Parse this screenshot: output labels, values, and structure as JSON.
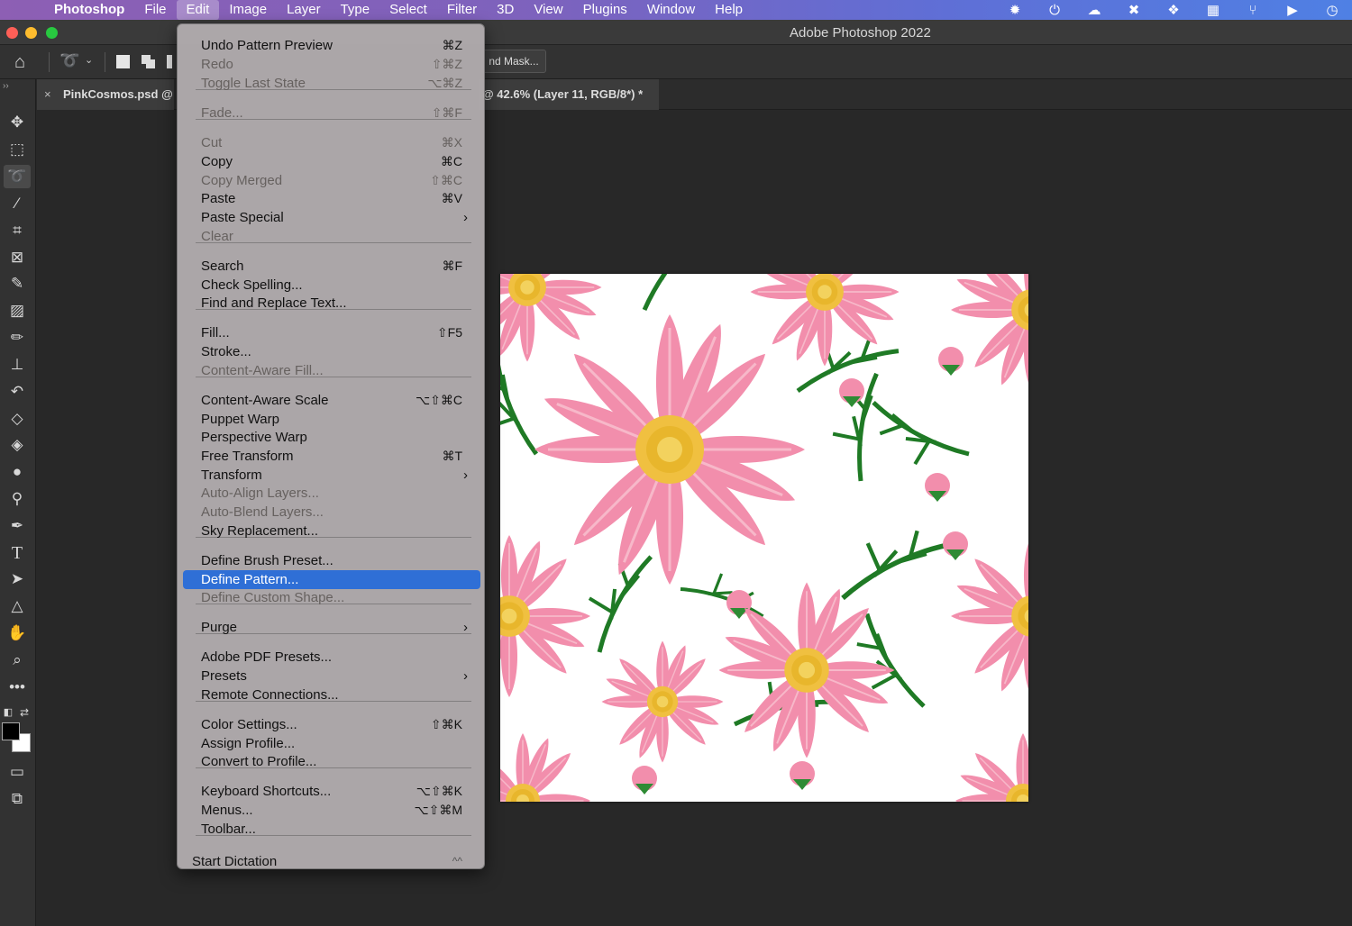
{
  "menubar": {
    "app_name": "Photoshop",
    "items": [
      "File",
      "Edit",
      "Image",
      "Layer",
      "Type",
      "Select",
      "Filter",
      "3D",
      "View",
      "Plugins",
      "Window",
      "Help"
    ]
  },
  "window": {
    "title": "Adobe Photoshop 2022"
  },
  "options_bar": {
    "mask_button_label": "nd Mask..."
  },
  "tabs": {
    "close_glyph": "×",
    "doc1_label": "PinkCosmos.psd @",
    "doc2_label": "@ 42.6% (Layer 11, RGB/8*) *"
  },
  "edit_menu": {
    "items": [
      {
        "label": "Undo Pattern Preview",
        "shortcut": "⌘Z",
        "enabled": true
      },
      {
        "label": "Redo",
        "shortcut": "⇧⌘Z",
        "enabled": false
      },
      {
        "label": "Toggle Last State",
        "shortcut": "⌥⌘Z",
        "enabled": false
      },
      {
        "label": "Fade...",
        "shortcut": "⇧⌘F",
        "enabled": false
      },
      {
        "label": "Cut",
        "shortcut": "⌘X",
        "enabled": false
      },
      {
        "label": "Copy",
        "shortcut": "⌘C",
        "enabled": true
      },
      {
        "label": "Copy Merged",
        "shortcut": "⇧⌘C",
        "enabled": false
      },
      {
        "label": "Paste",
        "shortcut": "⌘V",
        "enabled": true
      },
      {
        "label": "Paste Special",
        "shortcut": "›",
        "enabled": true
      },
      {
        "label": "Clear",
        "shortcut": "",
        "enabled": false
      },
      {
        "label": "Search",
        "shortcut": "⌘F",
        "enabled": true
      },
      {
        "label": "Check Spelling...",
        "shortcut": "",
        "enabled": true
      },
      {
        "label": "Find and Replace Text...",
        "shortcut": "",
        "enabled": true
      },
      {
        "label": "Fill...",
        "shortcut": "⇧F5",
        "enabled": true
      },
      {
        "label": "Stroke...",
        "shortcut": "",
        "enabled": true
      },
      {
        "label": "Content-Aware Fill...",
        "shortcut": "",
        "enabled": false
      },
      {
        "label": "Content-Aware Scale",
        "shortcut": "⌥⇧⌘C",
        "enabled": true
      },
      {
        "label": "Puppet Warp",
        "shortcut": "",
        "enabled": true
      },
      {
        "label": "Perspective Warp",
        "shortcut": "",
        "enabled": true
      },
      {
        "label": "Free Transform",
        "shortcut": "⌘T",
        "enabled": true
      },
      {
        "label": "Transform",
        "shortcut": "›",
        "enabled": true
      },
      {
        "label": "Auto-Align Layers...",
        "shortcut": "",
        "enabled": false
      },
      {
        "label": "Auto-Blend Layers...",
        "shortcut": "",
        "enabled": false
      },
      {
        "label": "Sky Replacement...",
        "shortcut": "",
        "enabled": true
      },
      {
        "label": "Define Brush Preset...",
        "shortcut": "",
        "enabled": true
      },
      {
        "label": "Define Pattern...",
        "shortcut": "",
        "enabled": true,
        "highlighted": true
      },
      {
        "label": "Define Custom Shape...",
        "shortcut": "",
        "enabled": false
      },
      {
        "label": "Purge",
        "shortcut": "›",
        "enabled": true
      },
      {
        "label": "Adobe PDF Presets...",
        "shortcut": "",
        "enabled": true
      },
      {
        "label": "Presets",
        "shortcut": "›",
        "enabled": true
      },
      {
        "label": "Remote Connections...",
        "shortcut": "",
        "enabled": true
      },
      {
        "label": "Color Settings...",
        "shortcut": "⇧⌘K",
        "enabled": true
      },
      {
        "label": "Assign Profile...",
        "shortcut": "",
        "enabled": true
      },
      {
        "label": "Convert to Profile...",
        "shortcut": "",
        "enabled": true
      },
      {
        "label": "Keyboard Shortcuts...",
        "shortcut": "⌥⇧⌘K",
        "enabled": true
      },
      {
        "label": "Menus...",
        "shortcut": "⌥⇧⌘M",
        "enabled": true
      },
      {
        "label": "Toolbar...",
        "shortcut": "",
        "enabled": true
      },
      {
        "label": "Start Dictation",
        "shortcut": "^^",
        "enabled": true
      }
    ]
  },
  "toolbar": {
    "tools": [
      "move-tool",
      "marquee-tool",
      "lasso-tool",
      "magic-wand-tool",
      "crop-tool",
      "frame-tool",
      "eyedropper-tool",
      "healing-brush-tool",
      "brush-tool",
      "clone-stamp-tool",
      "history-brush-tool",
      "eraser-tool",
      "paint-bucket-tool",
      "blur-tool",
      "dodge-tool",
      "pen-tool",
      "type-tool",
      "path-selection-tool",
      "shape-tool",
      "hand-tool",
      "zoom-tool",
      "more-tools"
    ],
    "foreground_color": "#000000",
    "background_color": "#ffffff"
  },
  "colors": {
    "menu_highlight": "#2f6fd6",
    "flower_pink": "#f28eac",
    "leaf_green": "#1f7a25",
    "flower_center": "#e8b62c"
  }
}
